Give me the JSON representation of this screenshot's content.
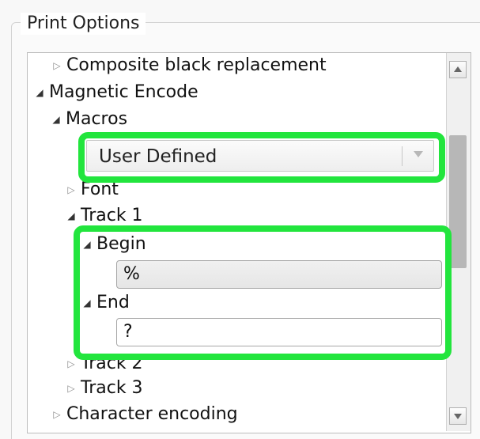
{
  "dialog": {
    "title": "Print Options"
  },
  "tree": {
    "composite": {
      "label": "Composite black replacement",
      "arrow": "▷"
    },
    "magnetic_encode": {
      "label": "Magnetic Encode",
      "arrow": "◢"
    },
    "macros": {
      "label": "Macros",
      "arrow": "◢"
    },
    "font": {
      "label": "Font",
      "arrow": "▷"
    },
    "track1": {
      "label": "Track 1",
      "arrow": "◢"
    },
    "begin": {
      "label": "Begin",
      "arrow": "◢",
      "value": "%"
    },
    "end": {
      "label": "End",
      "arrow": "◢",
      "value": "?"
    },
    "track2": {
      "label": "Track 2",
      "arrow": "▷"
    },
    "track3": {
      "label": "Track 3",
      "arrow": "▷"
    },
    "character_encoding": {
      "label": "Character encoding",
      "arrow": "▷"
    }
  },
  "macro_select": {
    "selected": "User Defined"
  },
  "highlights": {
    "color": "#22e53d"
  },
  "icons": {
    "expanded": "expanded-triangle-icon",
    "collapsed": "collapsed-triangle-icon",
    "dropdown": "chevron-down-icon",
    "scroll_up": "scroll-up-icon",
    "scroll_down": "scroll-down-icon"
  }
}
